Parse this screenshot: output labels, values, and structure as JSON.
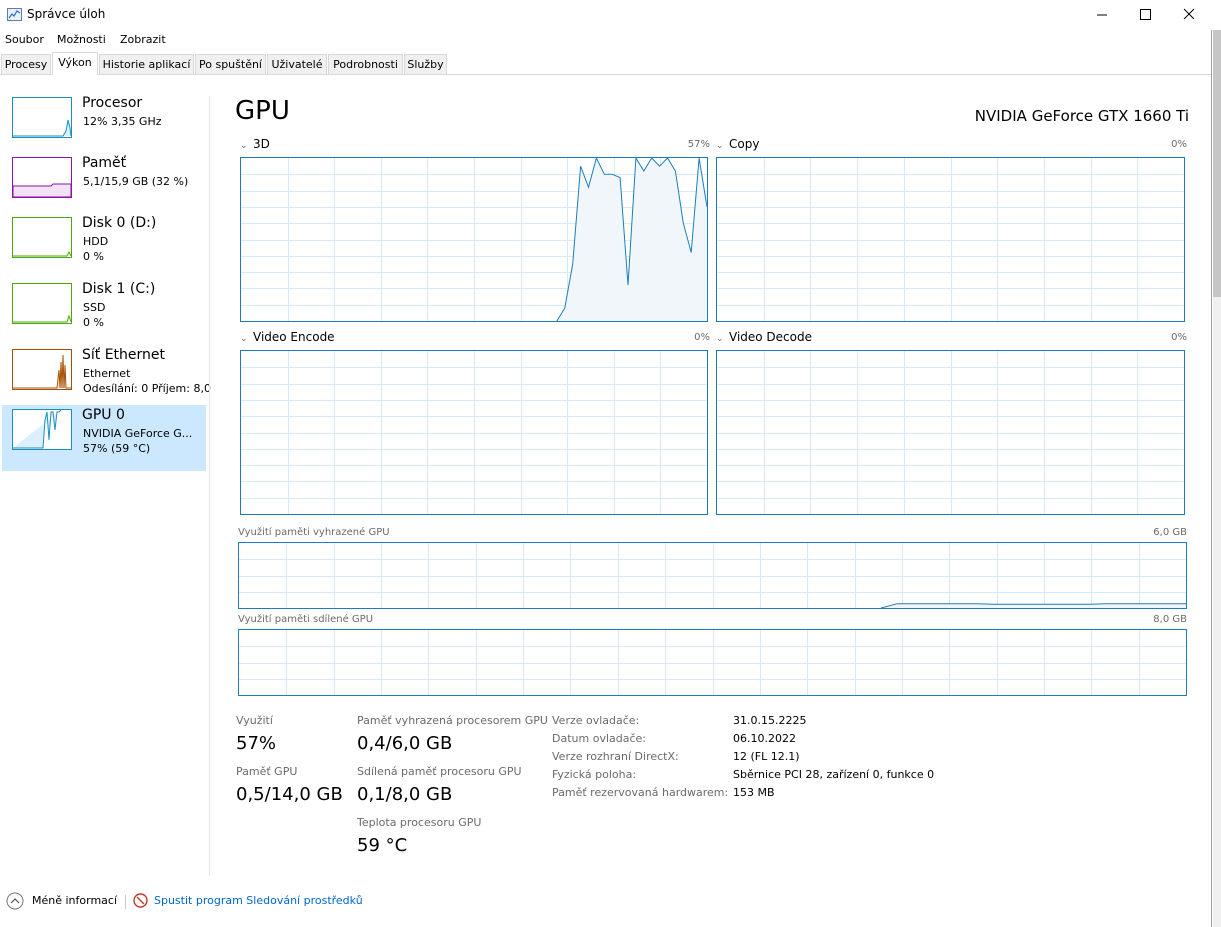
{
  "window": {
    "title": "Správce úloh",
    "icon": "task-manager-icon"
  },
  "menu": [
    "Soubor",
    "Možnosti",
    "Zobrazit"
  ],
  "tabs": [
    {
      "label": "Procesy",
      "active": false
    },
    {
      "label": "Výkon",
      "active": true
    },
    {
      "label": "Historie aplikací",
      "active": false
    },
    {
      "label": "Po spuštění",
      "active": false
    },
    {
      "label": "Uživatelé",
      "active": false
    },
    {
      "label": "Podrobnosti",
      "active": false
    },
    {
      "label": "Služby",
      "active": false
    }
  ],
  "sidebar": {
    "items": [
      {
        "title": "Procesor",
        "line1": "12% 3,35 GHz",
        "line2": "",
        "color": "#1a8fbf",
        "selected": false
      },
      {
        "title": "Paměť",
        "line1": "5,1/15,9 GB (32 %)",
        "line2": "",
        "color": "#8b12ae",
        "selected": false
      },
      {
        "title": "Disk 0 (D:)",
        "line1": "HDD",
        "line2": "0 %",
        "color": "#4da60c",
        "selected": false
      },
      {
        "title": "Disk 1 (C:)",
        "line1": "SSD",
        "line2": "0 %",
        "color": "#4da60c",
        "selected": false
      },
      {
        "title": "Síť Ethernet",
        "line1": "Ethernet",
        "line2": "Odesílání: 0 Příjem: 8,0",
        "color": "#a74f01",
        "selected": false
      },
      {
        "title": "GPU 0",
        "line1": "NVIDIA GeForce G...",
        "line2": "57% (59 °C)",
        "color": "#1a8fbf",
        "selected": true
      }
    ]
  },
  "gpu": {
    "heading": "GPU",
    "model": "NVIDIA GeForce GTX 1660 Ti",
    "engines": [
      {
        "label": "3D",
        "percent": "57%"
      },
      {
        "label": "Copy",
        "percent": "0%"
      },
      {
        "label": "Video Encode",
        "percent": "0%"
      },
      {
        "label": "Video Decode",
        "percent": "0%"
      }
    ],
    "dedicated_memory": {
      "label": "Využití paměti vyhrazené GPU",
      "max": "6,0 GB"
    },
    "shared_memory": {
      "label": "Využití paměti sdílené GPU",
      "max": "8,0 GB"
    }
  },
  "chart_data": [
    {
      "type": "area",
      "title": "3D",
      "ylim": [
        0,
        100
      ],
      "x": [
        0,
        1,
        2,
        3,
        4,
        5,
        6,
        7,
        8,
        9,
        10,
        11,
        12,
        13,
        14,
        15,
        16,
        17,
        18,
        19,
        20,
        21,
        22,
        23,
        24,
        25,
        26,
        27,
        28,
        29,
        30,
        31,
        32,
        33,
        34,
        35,
        36,
        37,
        38,
        39,
        40,
        41,
        42,
        43,
        44,
        45,
        46,
        47,
        48,
        49,
        50,
        51,
        52,
        53,
        54,
        55,
        56,
        57,
        58,
        59
      ],
      "values": [
        0,
        0,
        0,
        0,
        0,
        0,
        0,
        0,
        0,
        0,
        0,
        0,
        0,
        0,
        0,
        0,
        0,
        0,
        0,
        0,
        0,
        0,
        0,
        0,
        0,
        0,
        0,
        0,
        0,
        0,
        0,
        0,
        0,
        0,
        0,
        0,
        0,
        0,
        0,
        0,
        0,
        8,
        35,
        95,
        82,
        100,
        90,
        90,
        88,
        22,
        100,
        92,
        100,
        95,
        100,
        92,
        60,
        42,
        100,
        70
      ]
    },
    {
      "type": "area",
      "title": "Copy",
      "ylim": [
        0,
        100
      ],
      "values": []
    },
    {
      "type": "area",
      "title": "Video Encode",
      "ylim": [
        0,
        100
      ],
      "values": []
    },
    {
      "type": "area",
      "title": "Video Decode",
      "ylim": [
        0,
        100
      ],
      "values": []
    },
    {
      "type": "area",
      "title": "Využití paměti vyhrazené GPU",
      "ylim": [
        0,
        6.0
      ],
      "x": [
        0,
        1,
        2,
        3,
        4,
        5,
        6,
        7,
        8,
        9,
        10,
        11,
        12,
        13,
        14,
        15,
        16,
        17,
        18,
        19,
        20,
        21,
        22,
        23,
        24,
        25,
        26,
        27,
        28,
        29,
        30,
        31,
        32,
        33,
        34,
        35,
        36,
        37,
        38,
        39,
        40,
        41,
        42,
        43,
        44,
        45,
        46,
        47,
        48,
        49,
        50,
        51,
        52,
        53,
        54,
        55,
        56,
        57,
        58,
        59
      ],
      "values": [
        0,
        0,
        0,
        0,
        0,
        0,
        0,
        0,
        0,
        0,
        0,
        0,
        0,
        0,
        0,
        0,
        0,
        0,
        0,
        0,
        0,
        0,
        0,
        0,
        0,
        0,
        0,
        0,
        0,
        0,
        0,
        0,
        0,
        0,
        0,
        0,
        0,
        0,
        0,
        0,
        0,
        0.4,
        0.4,
        0.4,
        0.4,
        0.4,
        0.4,
        0.35,
        0.35,
        0.35,
        0.35,
        0.35,
        0.35,
        0.35,
        0.4,
        0.4,
        0.4,
        0.4,
        0.4,
        0.4
      ]
    },
    {
      "type": "area",
      "title": "Využití paměti sdílené GPU",
      "ylim": [
        0,
        8.0
      ],
      "values": []
    }
  ],
  "stats": {
    "utilization": {
      "label": "Využití",
      "value": "57%"
    },
    "gpu_memory": {
      "label": "Paměť GPU",
      "value": "0,5/14,0 GB"
    },
    "dedicated_mem": {
      "label": "Paměť vyhrazená procesorem GPU",
      "value": "0,4/6,0 GB"
    },
    "shared_mem": {
      "label": "Sdílená paměť procesoru GPU",
      "value": "0,1/8,0 GB"
    },
    "temperature": {
      "label": "Teplota procesoru GPU",
      "value": "59 °C"
    }
  },
  "info": [
    {
      "key": "Verze ovladače:",
      "value": "31.0.15.2225"
    },
    {
      "key": "Datum ovladače:",
      "value": "06.10.2022"
    },
    {
      "key": "Verze rozhraní DirectX:",
      "value": "12 (FL 12.1)"
    },
    {
      "key": "Fyzická poloha:",
      "value": "Sběrnice PCI 28, zařízení 0, funkce 0"
    },
    {
      "key": "Paměť rezervovaná hardwarem:",
      "value": "153 MB"
    }
  ],
  "footer": {
    "fewer_details": "Méně informací",
    "resource_monitor": "Spustit program Sledování prostředků"
  }
}
